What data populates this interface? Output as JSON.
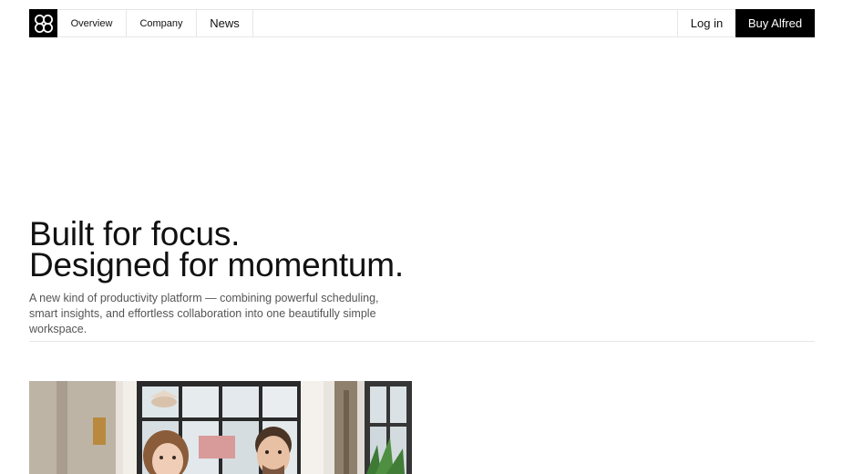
{
  "nav": {
    "logo_icon": "four-circles-logo-icon",
    "items": [
      {
        "label": "Overview"
      },
      {
        "label": "Company"
      },
      {
        "label": "News"
      }
    ],
    "login_label": "Log in",
    "buy_label": "Buy Alfred"
  },
  "hero": {
    "title_line1": "Built for focus.",
    "title_line2": "Designed for momentum.",
    "description": "A new kind of productivity platform — combining powerful scheduling, smart insights, and effortless collaboration into one beautifully simple workspace."
  },
  "photo": {
    "subject": "two-people-office-photo"
  },
  "colors": {
    "text": "#111111",
    "muted": "#555555",
    "border": "#e6e6e6",
    "button_bg": "#000000",
    "button_text": "#ffffff"
  }
}
